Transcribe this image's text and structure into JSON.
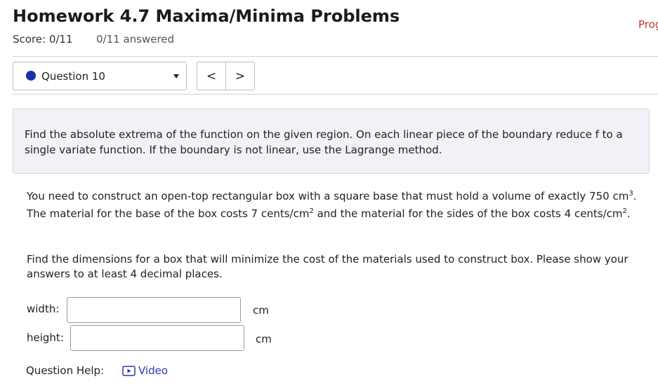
{
  "header": {
    "title": "Homework 4.7 Maxima/Minima Problems",
    "progress_label": "Prog",
    "score": "Score: 0/11",
    "answered": "0/11 answered"
  },
  "question_nav": {
    "current": "Question 10",
    "status_color": "#1a2ea8",
    "prev_label": "<",
    "next_label": ">"
  },
  "instructions": "Find the absolute extrema of the function on the given region. On each linear piece of the boundary reduce f to a single variate function. If the boundary is not linear, use the Lagrange method.",
  "problem": {
    "p1_a": "You need to construct an open-top rectangular box with a square base that must hold a volume of exactly 750 cm",
    "p1_sup1": "3",
    "p1_b": ". The material for the base of the box costs 7 cents/cm",
    "p1_sup2": "2",
    "p1_c": " and the material for the sides of the box costs 4 cents/cm",
    "p1_sup3": "2",
    "p1_d": ".",
    "p2": "Find the dimensions for a box that will minimize the cost of the materials used to construct box. Please show your answers to at least 4 decimal places."
  },
  "fields": [
    {
      "label": "width:",
      "value": "",
      "unit": "cm"
    },
    {
      "label": "height:",
      "value": "",
      "unit": "cm"
    }
  ],
  "help": {
    "label": "Question Help:",
    "video_label": "Video",
    "video_icon": "video-play-icon",
    "link_color": "#2a3aa8"
  }
}
